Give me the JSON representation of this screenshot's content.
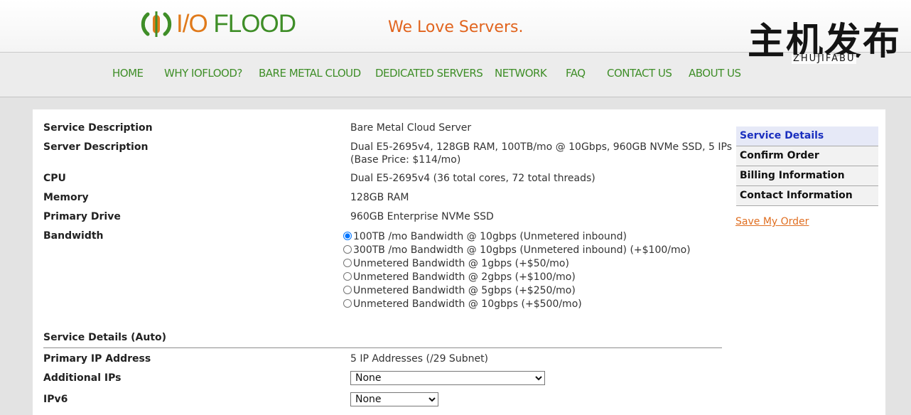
{
  "header": {
    "logo_io": "I/O",
    "logo_flood": "FLOOD",
    "tagline": "We Love Servers.",
    "watermark_cn": "主机发布",
    "watermark_en": "ZHUJIFABU"
  },
  "nav": {
    "items": [
      {
        "label": "HOME"
      },
      {
        "label": "WHY IOFLOOD?"
      },
      {
        "label": "BARE METAL CLOUD"
      },
      {
        "label": "DEDICATED SERVERS"
      },
      {
        "label": "NETWORK"
      },
      {
        "label": "FAQ"
      },
      {
        "label": "CONTACT US"
      },
      {
        "label": "ABOUT US"
      }
    ]
  },
  "details": {
    "service_description": {
      "label": "Service Description",
      "value": "Bare Metal Cloud Server"
    },
    "server_description": {
      "label": "Server Description",
      "value": "Dual E5-2695v4, 128GB RAM, 100TB/mo @ 10Gbps, 960GB NVMe SSD, 5 IPs (Base Price: $114/mo)"
    },
    "cpu": {
      "label": "CPU",
      "value": "Dual E5-2695v4 (36 total cores, 72 total threads)"
    },
    "memory": {
      "label": "Memory",
      "value": "128GB RAM"
    },
    "primary_drive": {
      "label": "Primary Drive",
      "value": "960GB Enterprise NVMe SSD"
    },
    "bandwidth": {
      "label": "Bandwidth",
      "options": [
        {
          "label": "100TB /mo Bandwidth @ 10gbps (Unmetered inbound)",
          "checked": true
        },
        {
          "label": "300TB /mo Bandwidth @ 10gbps (Unmetered inbound) (+$100/mo)",
          "checked": false
        },
        {
          "label": "Unmetered Bandwidth @ 1gbps (+$50/mo)",
          "checked": false
        },
        {
          "label": "Unmetered Bandwidth @ 2gbps (+$100/mo)",
          "checked": false
        },
        {
          "label": "Unmetered Bandwidth @ 5gbps (+$250/mo)",
          "checked": false
        },
        {
          "label": "Unmetered Bandwidth @ 10gbps (+$500/mo)",
          "checked": false
        }
      ]
    }
  },
  "auto_section": {
    "title": "Service Details (Auto)",
    "primary_ip": {
      "label": "Primary IP Address",
      "value": "5 IP Addresses (/29 Subnet)"
    },
    "additional_ips": {
      "label": "Additional IPs",
      "selected": "None"
    },
    "ipv6": {
      "label": "IPv6",
      "selected": "None"
    }
  },
  "sidebar": {
    "items": [
      {
        "label": "Service Details",
        "active": true
      },
      {
        "label": "Confirm Order",
        "active": false
      },
      {
        "label": "Billing Information",
        "active": false
      },
      {
        "label": "Contact Information",
        "active": false
      }
    ],
    "save_link": "Save My Order"
  },
  "colors": {
    "brand_green": "#3f8e28",
    "brand_orange": "#e07a1b",
    "active_sidebar_text": "#1a2fbf",
    "link_orange": "#e06f22"
  }
}
